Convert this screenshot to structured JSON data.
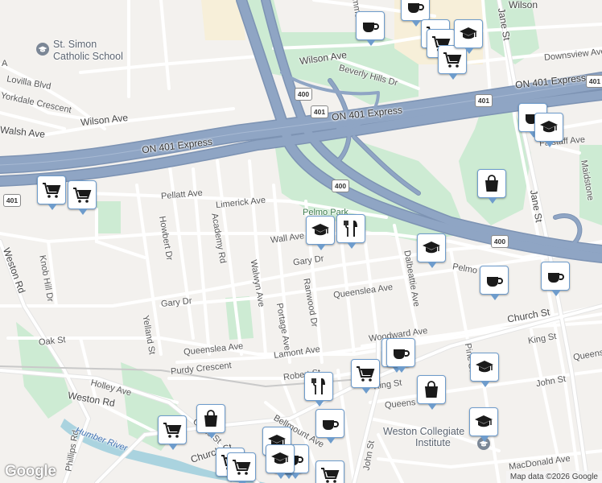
{
  "map": {
    "attribution": "Map data ©2026 Google",
    "logo": "Google",
    "streets": [
      {
        "name": "Wilson Ave"
      },
      {
        "name": "Wilson Ave"
      },
      {
        "name": "Wilson"
      },
      {
        "name": "Lovilla Blvd"
      },
      {
        "name": "Yorkdale Crescent"
      },
      {
        "name": "Walsh Ave"
      },
      {
        "name": "A"
      },
      {
        "name": "Beverly Hills Dr"
      },
      {
        "name": "Downsview Ave"
      },
      {
        "name": "Jane St"
      },
      {
        "name": "Jane St"
      },
      {
        "name": "Falstaff Ave"
      },
      {
        "name": "Maidstone"
      },
      {
        "name": "Pellatt Ave"
      },
      {
        "name": "Limerick Ave"
      },
      {
        "name": "Wall Ave"
      },
      {
        "name": "Gary Dr"
      },
      {
        "name": "Gary Dr"
      },
      {
        "name": "Queenslea Ave"
      },
      {
        "name": "Queenslea Ave"
      },
      {
        "name": "Queensl"
      },
      {
        "name": "Howbert Dr"
      },
      {
        "name": "Academy Rd"
      },
      {
        "name": "Walwyn Ave"
      },
      {
        "name": "Portage Ave"
      },
      {
        "name": "Ranwood Dr"
      },
      {
        "name": "Dalbeattie Ave"
      },
      {
        "name": "Pelmo"
      },
      {
        "name": "Knob Hill Dr"
      },
      {
        "name": "Weston Rd"
      },
      {
        "name": "Weston Rd"
      },
      {
        "name": "Yelland St"
      },
      {
        "name": "Oak St"
      },
      {
        "name": "Church St"
      },
      {
        "name": "Church St"
      },
      {
        "name": "Lamont Ave"
      },
      {
        "name": "Purdy Crescent"
      },
      {
        "name": "Holley Ave"
      },
      {
        "name": "Robert St"
      },
      {
        "name": "Woodward Ave"
      },
      {
        "name": "King St"
      },
      {
        "name": "King St"
      },
      {
        "name": "Pine St"
      },
      {
        "name": "John St"
      },
      {
        "name": "John St"
      },
      {
        "name": "Queens"
      },
      {
        "name": "MacDonald Ave"
      },
      {
        "name": "Phillips Rd"
      },
      {
        "name": "Bellmount Ave"
      },
      {
        "name": "Cross St"
      },
      {
        "name": "ON 401 Express"
      },
      {
        "name": "ON 401 Express"
      },
      {
        "name": "ON 401 Express"
      },
      {
        "name": "Trimmer"
      }
    ],
    "highway_shields": [
      "400",
      "401",
      "400",
      "401",
      "400",
      "401",
      "401"
    ],
    "places": {
      "school": "St. Simon Catholic School",
      "collegiate": "Weston Collegiate Institute",
      "park": "Pelmo Park",
      "river": "Humber River"
    },
    "pois": [
      "coffee-icon",
      "coffee-icon",
      "shopping-cart-icon",
      "shopping-cart-icon",
      "shopping-cart-icon",
      "school-icon",
      "shopping-cart-icon",
      "shopping-cart-icon",
      "shopping-bag-icon",
      "coffee-icon",
      "school-icon",
      "school-icon",
      "restaurant-icon",
      "school-icon",
      "coffee-icon",
      "coffee-icon",
      "shopping-bag-icon",
      "coffee-icon",
      "shopping-cart-icon",
      "restaurant-icon",
      "shopping-bag-icon",
      "school-icon",
      "coffee-icon",
      "school-icon",
      "shopping-cart-icon",
      "shopping-bag-icon",
      "school-icon",
      "shopping-cart-icon",
      "coffee-icon",
      "shopping-cart-icon",
      "shopping-cart-icon",
      "coffee-icon",
      "school-icon"
    ],
    "colors": {
      "land": "#f3f1ee",
      "park": "#cdebd3",
      "highway": "#8fa5c4",
      "highway_casing": "#7d93b3",
      "road": "#ffffff",
      "water": "#aad3df",
      "poi_border": "#6e9ccc",
      "poi_icon": "#1a1a1a"
    }
  }
}
